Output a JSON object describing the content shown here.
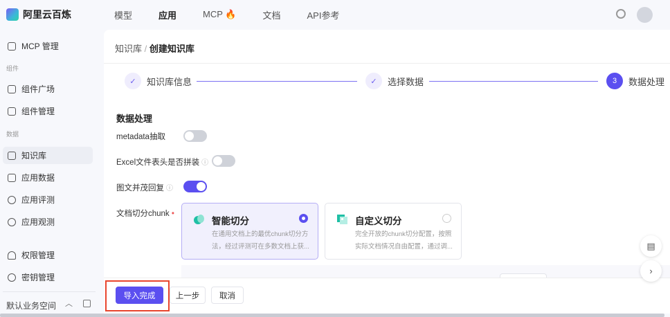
{
  "brand": "阿里云百炼",
  "nav": [
    "模型",
    "应用",
    "MCP 🔥",
    "文档",
    "API参考"
  ],
  "sidebar": {
    "mcp": "MCP 管理",
    "sec_components": "组件",
    "components_square": "组件广场",
    "components_manage": "组件管理",
    "sec_data": "数据",
    "knowledge": "知识库",
    "app_data": "应用数据",
    "app_eval": "应用评测",
    "app_observe": "应用观测",
    "permissions": "权限管理",
    "keys": "密钥管理",
    "workspace": "默认业务空间"
  },
  "breadcrumb": {
    "parent": "知识库",
    "sep": "/",
    "current": "创建知识库"
  },
  "steps": [
    {
      "label": "知识库信息",
      "status": "done"
    },
    {
      "label": "选择数据",
      "status": "done"
    },
    {
      "label": "数据处理",
      "num": "3",
      "status": "current"
    }
  ],
  "form": {
    "title": "数据处理",
    "metadata": {
      "label": "metadata抽取",
      "on": false
    },
    "excel": {
      "label": "Excel文件表头是否拼装",
      "on": false
    },
    "image": {
      "label": "图文并茂回复",
      "on": true
    },
    "chunk_label": "文档切分chunk",
    "options": [
      {
        "title": "智能切分",
        "desc": "在通用文档上的最优chunk切分方法，经过评测可在多数文档上获...",
        "selected": true
      },
      {
        "title": "自定义切分",
        "desc": "完全开放的chunk切分配置，按照实际文档情况自由配置，通过调...",
        "selected": false
      }
    ]
  },
  "footer": {
    "finish": "导入完成",
    "prev": "上一步",
    "cancel": "取消"
  },
  "colors": {
    "accent": "#5b4ff0",
    "highlight": "#e8452e"
  }
}
